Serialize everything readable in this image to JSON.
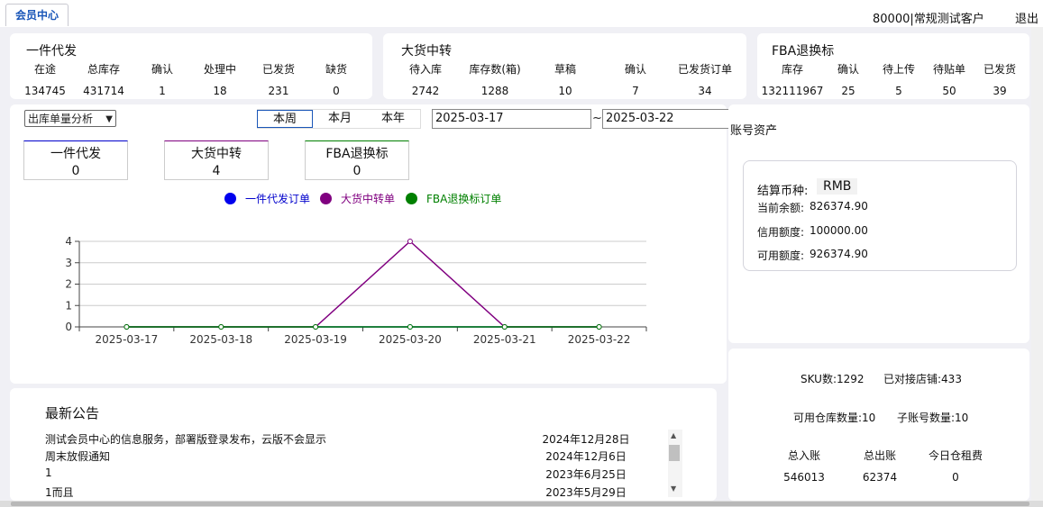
{
  "header": {
    "tab_label": "会员中心",
    "user": "80000|常规测试客户",
    "logout": "退出"
  },
  "cards": [
    {
      "title": "一件代发",
      "stats": [
        {
          "label": "在途",
          "value": "134745"
        },
        {
          "label": "总库存",
          "value": "431714"
        },
        {
          "label": "确认",
          "value": "1"
        },
        {
          "label": "处理中",
          "value": "18"
        },
        {
          "label": "已发货",
          "value": "231"
        },
        {
          "label": "缺货",
          "value": "0"
        }
      ]
    },
    {
      "title": "大货中转",
      "stats": [
        {
          "label": "待入库",
          "value": "2742"
        },
        {
          "label": "库存数(箱)",
          "value": "1288"
        },
        {
          "label": "草稿",
          "value": "10"
        },
        {
          "label": "确认",
          "value": "7"
        },
        {
          "label": "已发货订单",
          "value": "34"
        }
      ]
    },
    {
      "title": "FBA退换标",
      "stats": [
        {
          "label": "库存",
          "value": "132111967"
        },
        {
          "label": "确认",
          "value": "25"
        },
        {
          "label": "待上传",
          "value": "5"
        },
        {
          "label": "待贴单",
          "value": "50"
        },
        {
          "label": "已发货",
          "value": "39"
        }
      ]
    }
  ],
  "analysis": {
    "select_value": "出库单量分析",
    "periods": [
      "本周",
      "本月",
      "本年"
    ],
    "active_period": "本周",
    "date_from": "2025-03-17",
    "date_sep": "~",
    "date_to": "2025-03-22",
    "summary": [
      {
        "label": "一件代发",
        "value": "0",
        "color": "#0000cc"
      },
      {
        "label": "大货中转",
        "value": "4",
        "color": "#800080"
      },
      {
        "label": "FBA退换标",
        "value": "0",
        "color": "#008000"
      }
    ]
  },
  "chart_data": {
    "type": "line",
    "x": [
      "2025-03-17",
      "2025-03-18",
      "2025-03-19",
      "2025-03-20",
      "2025-03-21",
      "2025-03-22"
    ],
    "ylim": [
      0,
      4
    ],
    "yticks": [
      0,
      1,
      2,
      3,
      4
    ],
    "grid": true,
    "legend": "top-center",
    "series": [
      {
        "name": "一件代发订单",
        "color": "#0000ee",
        "values": [
          0,
          0,
          0,
          0,
          0,
          0
        ]
      },
      {
        "name": "大货中转单",
        "color": "#800080",
        "values": [
          0,
          0,
          0,
          4,
          0,
          0
        ]
      },
      {
        "name": "FBA退换标订单",
        "color": "#008000",
        "values": [
          0,
          0,
          0,
          0,
          0,
          0
        ]
      }
    ]
  },
  "account": {
    "title": "账号资产",
    "currency_label": "结算币种:",
    "currency_value": "RMB",
    "balance_label": "当前余额:",
    "balance_value": "826374.90",
    "credit_label": "信用额度:",
    "credit_value": "100000.00",
    "available_label": "可用额度:",
    "available_value": "926374.90"
  },
  "overview": {
    "sku": "SKU数:1292",
    "stores": "已对接店铺:433",
    "warehouses": "可用仓库数量:10",
    "subaccounts": "子账号数量:10",
    "headers": [
      "总入账",
      "总出账",
      "今日仓租费"
    ],
    "values": [
      "546013",
      "62374",
      "0"
    ]
  },
  "notices": {
    "title": "最新公告",
    "items": [
      {
        "text": "测试会员中心的信息服务，部署版登录发布，云版不会显示",
        "date": "2024年12月28日"
      },
      {
        "text": "周末放假通知",
        "date": "2024年12月6日"
      },
      {
        "text": "1",
        "date": "2023年6月25日"
      },
      {
        "text": "1而且",
        "date": "2023年5月29日"
      }
    ]
  }
}
